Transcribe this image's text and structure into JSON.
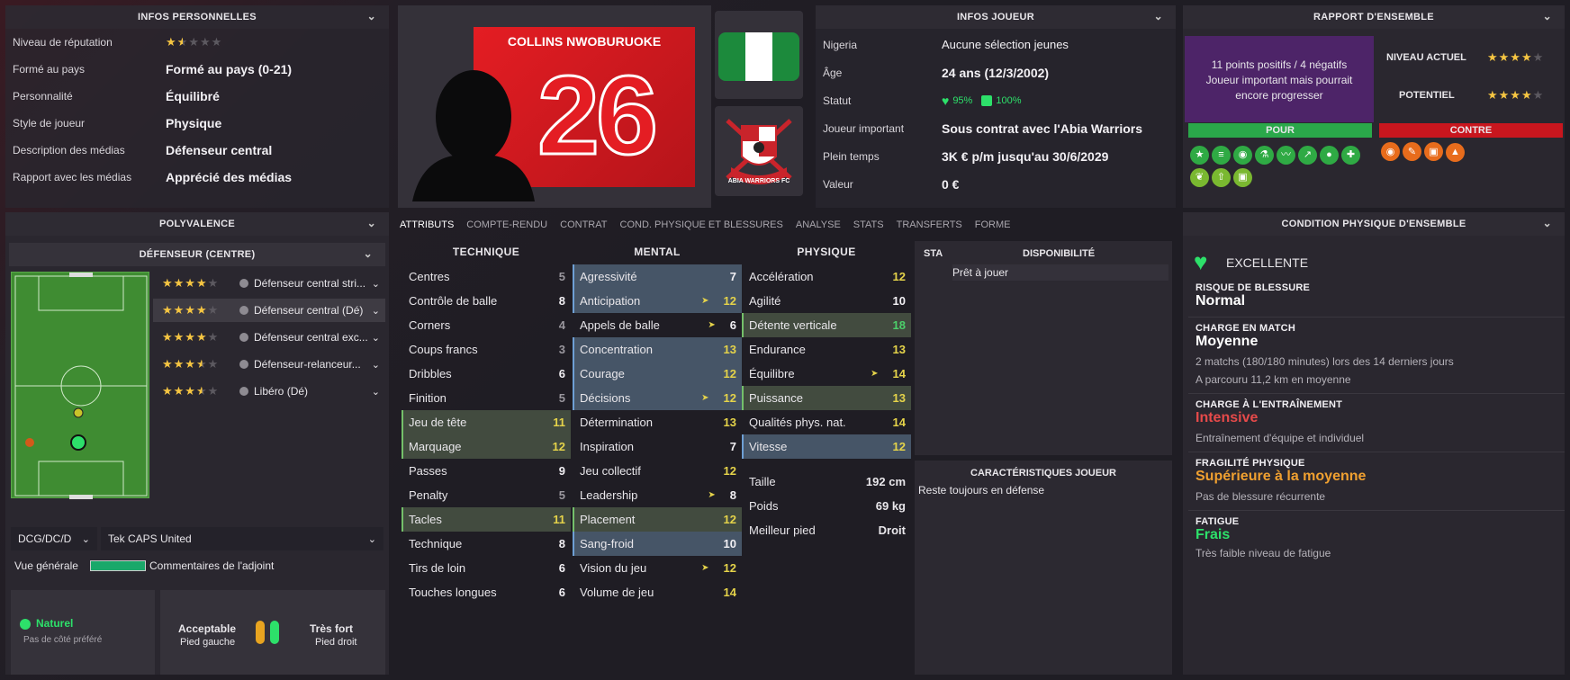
{
  "personal": {
    "header": "INFOS PERSONNELLES",
    "rows": [
      {
        "label": "Niveau de réputation",
        "value": ""
      },
      {
        "label": "Formé au pays",
        "value": "Formé au pays (0-21)"
      },
      {
        "label": "Personnalité",
        "value": "Équilibré"
      },
      {
        "label": "Style de joueur",
        "value": "Physique"
      },
      {
        "label": "Description des médias",
        "value": "Défenseur central"
      },
      {
        "label": "Rapport avec les médias",
        "value": "Apprécié des médias"
      }
    ],
    "reputation_stars": 1.5
  },
  "player": {
    "name": "COLLINS NWOBURUOKE",
    "number": "26",
    "club_badge_text": "ABIA WARRIORS FC",
    "flag_colors": [
      "#1c8a3c",
      "#ffffff",
      "#1c8a3c"
    ]
  },
  "info": {
    "header": "INFOS JOUEUR",
    "rows": [
      {
        "label": "Nigeria",
        "value": "Aucune sélection jeunes"
      },
      {
        "label": "Âge",
        "value": "24 ans (12/3/2002)"
      },
      {
        "label": "Statut",
        "value": ""
      },
      {
        "label": "Joueur important",
        "value": "Sous contrat avec l'Abia Warriors"
      },
      {
        "label": "Plein temps",
        "value": "3K € p/m jusqu'au 30/6/2029"
      },
      {
        "label": "Valeur",
        "value": "0 €"
      }
    ],
    "status_condition": "95%",
    "status_sharpness": "100%"
  },
  "report": {
    "header": "RAPPORT D'ENSEMBLE",
    "summary": "11 points positifs / 4 négatifs",
    "note": "Joueur important mais pourrait encore progresser",
    "current_label": "NIVEAU ACTUEL",
    "potential_label": "POTENTIEL",
    "current_stars": 4,
    "potential_stars": 4,
    "pros_label": "POUR",
    "cons_label": "CONTRE",
    "pros_icons": [
      "star-icon",
      "ladder-icon",
      "whistle-icon",
      "flask-icon",
      "wave-icon",
      "trend-icon",
      "head-icon",
      "bandage-icon",
      "leaf-icon",
      "arrow-up-icon",
      "card-icon"
    ],
    "cons_icons": [
      "whistle-icon",
      "wrench-icon",
      "card-icon",
      "cone-icon"
    ]
  },
  "versatility": {
    "header": "POLYVALENCE",
    "position_header": "DÉFENSEUR (CENTRE)",
    "roles": [
      {
        "label": "Défenseur central stri...",
        "stars": 4
      },
      {
        "label": "Défenseur central (Dé)",
        "stars": 4
      },
      {
        "label": "Défenseur central exc...",
        "stars": 4
      },
      {
        "label": "Défenseur-relanceur...",
        "stars": 3.5
      },
      {
        "label": "Libéro (Dé)",
        "stars": 3.5
      }
    ],
    "position_select": "DCG/DC/D",
    "team_select": "Tek CAPS United",
    "overview_label": "Vue générale",
    "assistant_label": "Commentaires de l'adjoint",
    "foot_side_title": "Naturel",
    "foot_side_sub": "Pas de côté préféré",
    "left_foot_level": "Acceptable",
    "left_foot_label": "Pied gauche",
    "right_foot_level": "Très fort",
    "right_foot_label": "Pied droit"
  },
  "tabs": [
    "ATTRIBUTS",
    "COMPTE-RENDU",
    "CONTRAT",
    "COND. PHYSIQUE ET BLESSURES",
    "ANALYSE",
    "STATS",
    "TRANSFERTS",
    "FORME"
  ],
  "attributes": {
    "technique_title": "TECHNIQUE",
    "mental_title": "MENTAL",
    "physique_title": "PHYSIQUE",
    "technique": [
      {
        "name": "Centres",
        "value": "5",
        "hl": ""
      },
      {
        "name": "Contrôle de balle",
        "value": "8",
        "hl": ""
      },
      {
        "name": "Corners",
        "value": "4",
        "hl": ""
      },
      {
        "name": "Coups francs",
        "value": "3",
        "hl": ""
      },
      {
        "name": "Dribbles",
        "value": "6",
        "hl": ""
      },
      {
        "name": "Finition",
        "value": "5",
        "hl": ""
      },
      {
        "name": "Jeu de tête",
        "value": "11",
        "hl": "gr"
      },
      {
        "name": "Marquage",
        "value": "12",
        "hl": "gr"
      },
      {
        "name": "Passes",
        "value": "9",
        "hl": ""
      },
      {
        "name": "Penalty",
        "value": "5",
        "hl": ""
      },
      {
        "name": "Tacles",
        "value": "11",
        "hl": "gr"
      },
      {
        "name": "Technique",
        "value": "8",
        "hl": ""
      },
      {
        "name": "Tirs de loin",
        "value": "6",
        "hl": ""
      },
      {
        "name": "Touches longues",
        "value": "6",
        "hl": ""
      }
    ],
    "mental": [
      {
        "name": "Agressivité",
        "value": "7",
        "hl": "bl",
        "arrow": false
      },
      {
        "name": "Anticipation",
        "value": "12",
        "hl": "bl",
        "arrow": true
      },
      {
        "name": "Appels de balle",
        "value": "6",
        "hl": "",
        "arrow": true
      },
      {
        "name": "Concentration",
        "value": "13",
        "hl": "bl",
        "arrow": false
      },
      {
        "name": "Courage",
        "value": "12",
        "hl": "bl",
        "arrow": false
      },
      {
        "name": "Décisions",
        "value": "12",
        "hl": "bl",
        "arrow": true
      },
      {
        "name": "Détermination",
        "value": "13",
        "hl": "",
        "arrow": false
      },
      {
        "name": "Inspiration",
        "value": "7",
        "hl": "",
        "arrow": false
      },
      {
        "name": "Jeu collectif",
        "value": "12",
        "hl": "",
        "arrow": false
      },
      {
        "name": "Leadership",
        "value": "8",
        "hl": "",
        "arrow": true
      },
      {
        "name": "Placement",
        "value": "12",
        "hl": "gr",
        "arrow": false
      },
      {
        "name": "Sang-froid",
        "value": "10",
        "hl": "bl",
        "arrow": false
      },
      {
        "name": "Vision du jeu",
        "value": "12",
        "hl": "",
        "arrow": true
      },
      {
        "name": "Volume de jeu",
        "value": "14",
        "hl": "",
        "arrow": false
      }
    ],
    "physique": [
      {
        "name": "Accélération",
        "value": "12",
        "hl": "",
        "arrow": false
      },
      {
        "name": "Agilité",
        "value": "10",
        "hl": "",
        "arrow": false
      },
      {
        "name": "Détente verticale",
        "value": "18",
        "hl": "gr",
        "arrow": false
      },
      {
        "name": "Endurance",
        "value": "13",
        "hl": "",
        "arrow": false
      },
      {
        "name": "Équilibre",
        "value": "14",
        "hl": "",
        "arrow": true
      },
      {
        "name": "Puissance",
        "value": "13",
        "hl": "gr",
        "arrow": false
      },
      {
        "name": "Qualités phys. nat.",
        "value": "14",
        "hl": "",
        "arrow": false
      },
      {
        "name": "Vitesse",
        "value": "12",
        "hl": "bl",
        "arrow": false
      }
    ],
    "height_label": "Taille",
    "height": "192 cm",
    "weight_label": "Poids",
    "weight": "69 kg",
    "foot_label": "Meilleur pied",
    "foot": "Droit"
  },
  "availability": {
    "sta": "STA",
    "title": "DISPONIBILITÉ",
    "status": "Prêt à jouer"
  },
  "traits": {
    "title": "CARACTÉRISTIQUES JOUEUR",
    "items": [
      "Reste toujours en défense"
    ]
  },
  "condition": {
    "header": "CONDITION PHYSIQUE D'ENSEMBLE",
    "overall": "EXCELLENTE",
    "injury_risk_label": "RISQUE DE BLESSURE",
    "injury_risk": "Normal",
    "match_load_label": "CHARGE EN MATCH",
    "match_load": "Moyenne",
    "match_load_sub1": "2 matchs (180/180 minutes) lors des 14 derniers jours",
    "match_load_sub2": "A parcouru 11,2 km en moyenne",
    "training_label": "CHARGE À L'ENTRAÎNEMENT",
    "training": "Intensive",
    "training_sub": "Entraînement d'équipe et individuel",
    "fragility_label": "FRAGILITÉ PHYSIQUE",
    "fragility": "Supérieure à la moyenne",
    "fragility_sub": "Pas de blessure récurrente",
    "fatigue_label": "FATIGUE",
    "fatigue": "Frais",
    "fatigue_sub": "Très faible niveau de fatigue"
  }
}
